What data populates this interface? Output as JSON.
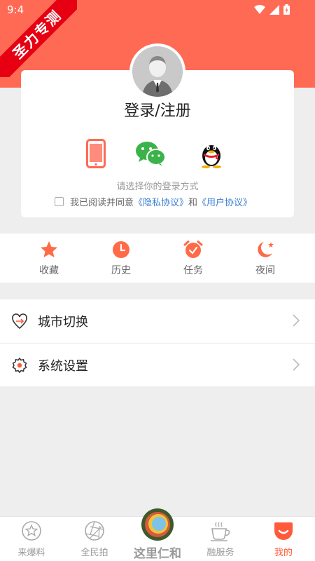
{
  "status_bar": {
    "time": "9:4"
  },
  "ribbon": {
    "text": "圣力专测"
  },
  "login": {
    "title": "登录/注册",
    "methods": [
      "phone-icon",
      "wechat-icon",
      "qq-icon"
    ],
    "hint": "请选择你的登录方式",
    "agree_prefix": "我已阅读并同意",
    "privacy_link": "《隐私协议》",
    "and": "和",
    "user_link": "《用户协议》"
  },
  "quick": [
    {
      "label": "收藏",
      "icon": "star-icon"
    },
    {
      "label": "历史",
      "icon": "clock-icon"
    },
    {
      "label": "任务",
      "icon": "alarm-icon"
    },
    {
      "label": "夜间",
      "icon": "moon-icon"
    }
  ],
  "menu": [
    {
      "label": "城市切换",
      "icon": "city-switch-icon"
    },
    {
      "label": "系统设置",
      "icon": "settings-icon"
    }
  ],
  "tabs": [
    {
      "label": "来爆料",
      "icon": "star-badge-icon"
    },
    {
      "label": "全民拍",
      "icon": "aperture-icon"
    },
    {
      "label": "这里仁和",
      "icon": "logo-icon"
    },
    {
      "label": "融服务",
      "icon": "coffee-icon"
    },
    {
      "label": "我的",
      "icon": "profile-icon"
    }
  ],
  "colors": {
    "accent": "#ff6a55",
    "link": "#3b7fd1",
    "active_tab": "#ff5a3c",
    "ribbon": "#e60012"
  }
}
